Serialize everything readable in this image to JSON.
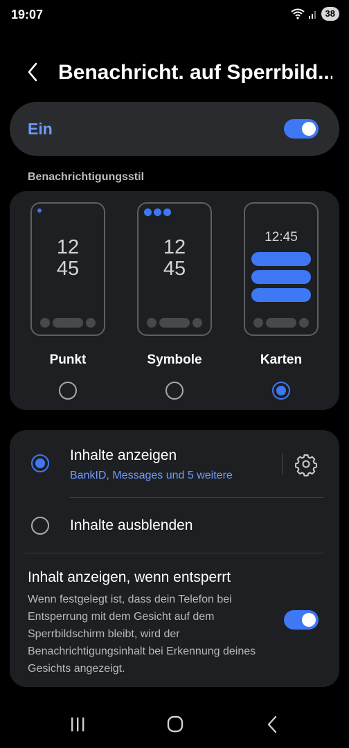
{
  "status_bar": {
    "time": "19:07",
    "battery": "38",
    "icons": [
      "wifi-icon",
      "signal-icon",
      "battery-icon"
    ]
  },
  "header": {
    "back_icon": "back-chevron-icon",
    "title": "Benachricht. auf Sperrbild..."
  },
  "master_switch": {
    "label": "Ein",
    "on": true
  },
  "style_section": {
    "label": "Benachrichtigungsstil",
    "options": [
      {
        "label": "Punkt",
        "selected": false,
        "clock_hours": "12",
        "clock_minutes": "45"
      },
      {
        "label": "Symbole",
        "selected": false,
        "clock_hours": "12",
        "clock_minutes": "45"
      },
      {
        "label": "Karten",
        "selected": true,
        "clock_time": "12:45"
      }
    ]
  },
  "content_section": {
    "show": {
      "title": "Inhalte anzeigen",
      "subtitle": "BankID, Messages und 5 weitere",
      "selected": true,
      "settings_icon": "gear-icon"
    },
    "hide": {
      "title": "Inhalte ausblenden",
      "selected": false
    },
    "unlock": {
      "title": "Inhalt anzeigen, wenn entsperrt",
      "description": "Wenn festgelegt ist, dass dein Telefon bei Entsperrung mit dem Gesicht auf dem Sperrbildschirm bleibt, wird der Benachrichtigungsinhalt bei Erkennung deines Gesichts angezeigt.",
      "on": true
    }
  },
  "nav_bar": {
    "icons": [
      "recents-icon",
      "home-icon",
      "back-icon"
    ]
  },
  "colors": {
    "accent": "#3e78f4",
    "accent_text": "#6d9cff",
    "card_bg": "#1e1f22",
    "background": "#000000"
  }
}
